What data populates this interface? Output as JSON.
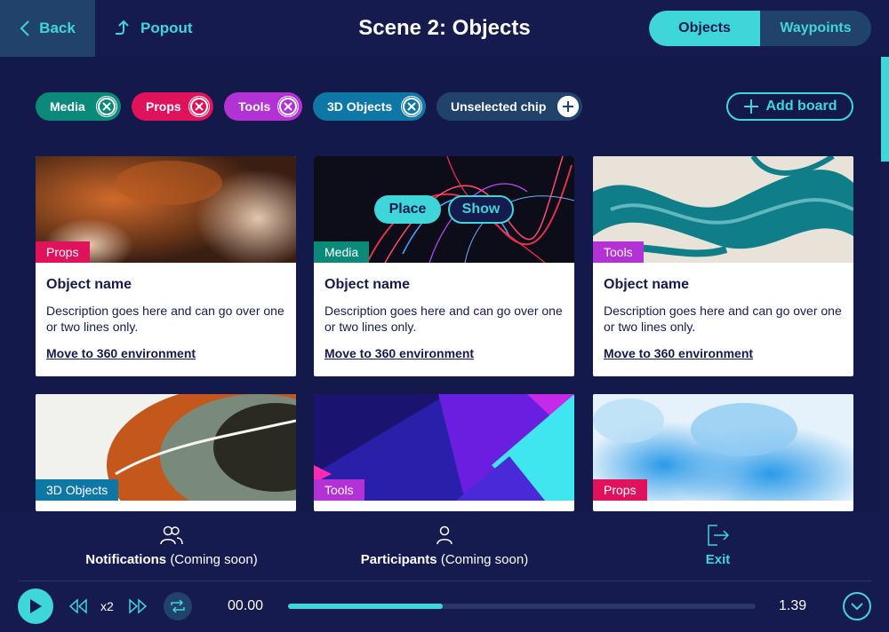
{
  "header": {
    "back_label": "Back",
    "popout_label": "Popout",
    "title": "Scene 2: Objects",
    "tabs": [
      {
        "label": "Objects",
        "active": true
      },
      {
        "label": "Waypoints",
        "active": false
      }
    ]
  },
  "chips": [
    {
      "label": "Media",
      "color": "#0b8a79",
      "selected": true
    },
    {
      "label": "Props",
      "color": "#e0125c",
      "selected": true
    },
    {
      "label": "Tools",
      "color": "#b232d6",
      "selected": true
    },
    {
      "label": "3D Objects",
      "color": "#0e77a6",
      "selected": true
    },
    {
      "label": "Unselected chip",
      "color": "#21426a",
      "selected": false
    }
  ],
  "add_board_label": "Add board",
  "cards": [
    {
      "tag": "Props",
      "tag_color": "#e0125c",
      "name": "Object name",
      "desc": "Description goes here and can go over one or two lines only.",
      "link": "Move to 360 environment"
    },
    {
      "tag": "Media",
      "tag_color": "#0b8a79",
      "name": "Object name",
      "desc": "Description goes here and can go over one or two lines only.",
      "link": "Move to 360 environment",
      "actions": {
        "place": "Place",
        "show": "Show"
      }
    },
    {
      "tag": "Tools",
      "tag_color": "#b232d6",
      "name": "Object name",
      "desc": "Description goes here and can go over one or two lines only.",
      "link": "Move to 360 environment"
    },
    {
      "tag": "3D Objects",
      "tag_color": "#0e77a6"
    },
    {
      "tag": "Tools",
      "tag_color": "#b232d6"
    },
    {
      "tag": "Props",
      "tag_color": "#e0125c"
    }
  ],
  "footer": {
    "notifications": {
      "label": "Notifications",
      "note": "(Coming soon)"
    },
    "participants": {
      "label": "Participants",
      "note": "(Coming soon)"
    },
    "exit_label": "Exit"
  },
  "player": {
    "speed": "x2",
    "current_time": "00.00",
    "total_time": "1.39",
    "progress": 0.33
  },
  "colors": {
    "accent": "#3fd6da",
    "background": "#13194a",
    "panel": "#151a4f"
  }
}
